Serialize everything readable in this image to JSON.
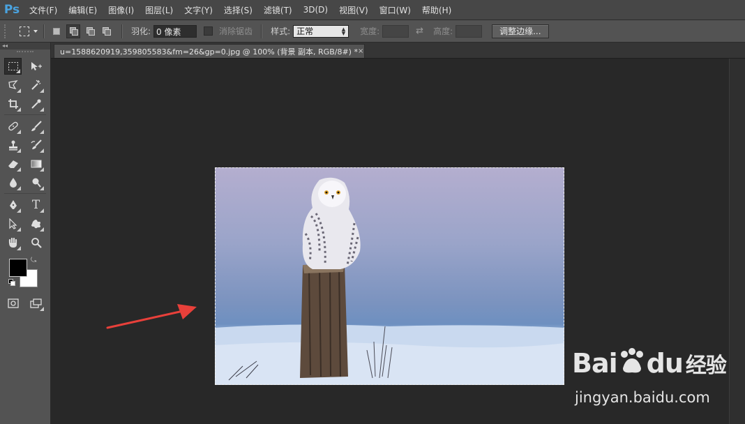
{
  "app": {
    "logo": "Ps"
  },
  "menu": [
    "文件(F)",
    "编辑(E)",
    "图像(I)",
    "图层(L)",
    "文字(Y)",
    "选择(S)",
    "滤镜(T)",
    "3D(D)",
    "视图(V)",
    "窗口(W)",
    "帮助(H)"
  ],
  "options": {
    "feather_label": "羽化:",
    "feather_value": "0 像素",
    "antialias_label": "消除锯齿",
    "style_label": "样式:",
    "style_value": "正常",
    "width_label": "宽度:",
    "height_label": "高度:",
    "refine_edge": "调整边缘..."
  },
  "toolbox": {
    "collapse": "◂◂"
  },
  "document": {
    "tab_title": "u=1588620919,359805583&fm=26&gp=0.jpg @ 100% (背景 副本, RGB/8#) *",
    "close": "×"
  },
  "colors": {
    "foreground": "#000000",
    "background": "#ffffff",
    "annotation_arrow": "#e8403a"
  },
  "watermark": {
    "brand_latin": "Bai",
    "brand_du": "du",
    "brand_cn": "经验",
    "url": "jingyan.baidu.com"
  }
}
